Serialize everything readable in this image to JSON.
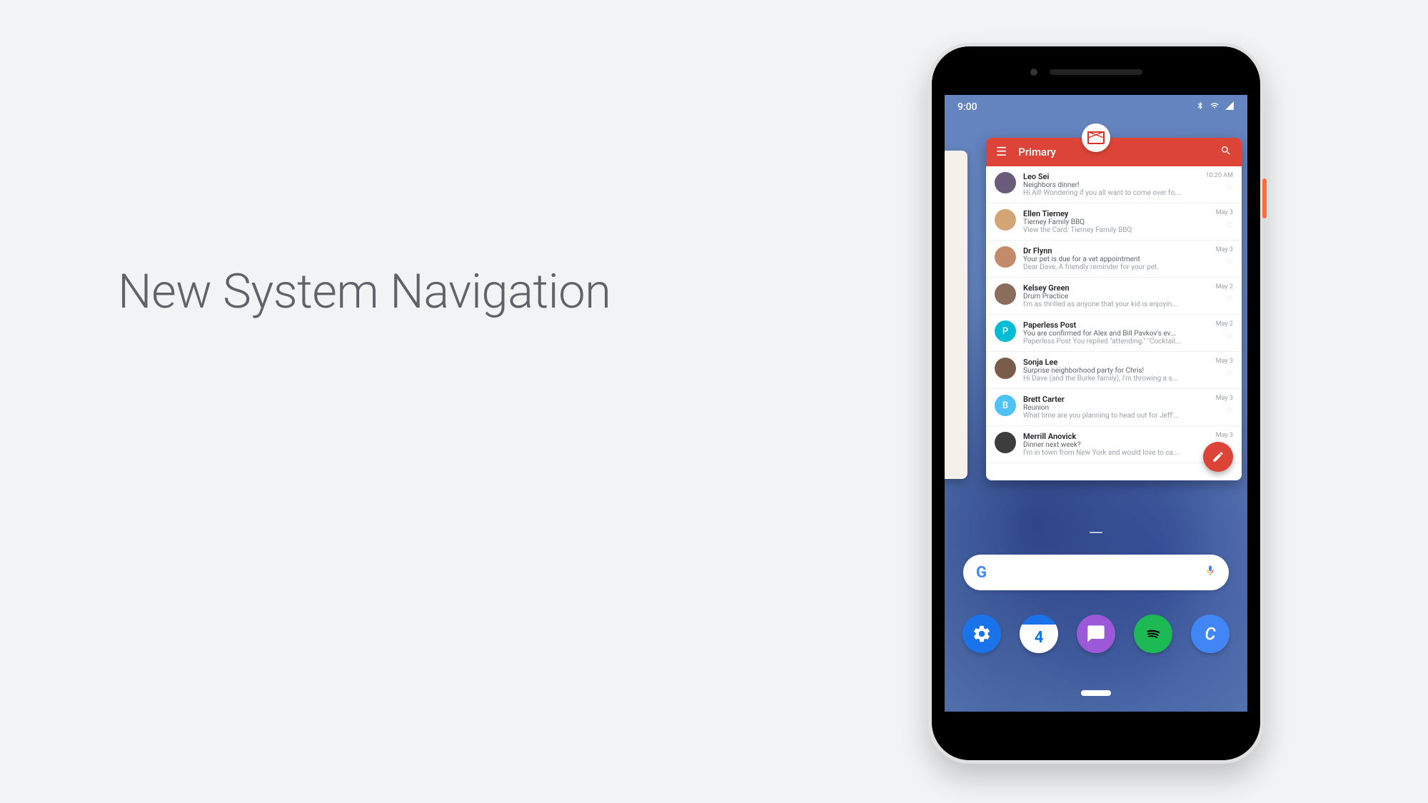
{
  "headline": "New System Navigation",
  "status": {
    "time": "9:00"
  },
  "gmail": {
    "tab_label": "Primary",
    "emails": [
      {
        "sender": "Leo Sei",
        "subject": "Neighbors dinner!",
        "preview": "Hi All! Wondering if you all want to come over fo...",
        "time": "10:20 AM",
        "avatar_bg": "#6b5b7b"
      },
      {
        "sender": "Ellen Tierney",
        "subject": "Tierney Family BBQ",
        "preview": "View the Card: Tierney Family BBQ",
        "time": "May 3",
        "avatar_bg": "#d4a574"
      },
      {
        "sender": "Dr Flynn",
        "subject": "Your pet is due for a vet appointment",
        "preview": "Dear Dave, A friendly reminder for your pet.",
        "time": "May 3",
        "avatar_bg": "#c48b6a"
      },
      {
        "sender": "Kelsey Green",
        "subject": "Drum Practice",
        "preview": "I'm as thrilled as anyone that your kid is enjoyin...",
        "time": "May 2",
        "avatar_bg": "#8a6d5a"
      },
      {
        "sender": "Paperless Post",
        "subject": "You are confirmed for Alex and Bill Pavkov's ev...",
        "preview": "Paperless Post You replied \"attending.\" \"Cocktail...",
        "time": "May 2",
        "avatar_bg": "#00bcd4",
        "letter": "P"
      },
      {
        "sender": "Sonja Lee",
        "subject": "Surprise neighborhood party for Chris!",
        "preview": "Hi Dave (and the Burke family), I'm throwing a s...",
        "time": "May 3",
        "avatar_bg": "#7a5c4a"
      },
      {
        "sender": "Brett Carter",
        "subject": "Reunion",
        "preview": "What time are you planning to head out for Jeff'...",
        "time": "May 3",
        "avatar_bg": "#4fc3f7",
        "letter": "B"
      },
      {
        "sender": "Merrill Anovick",
        "subject": "Dinner next week?",
        "preview": "I'm in town from New York and would love to ca...",
        "time": "May 3",
        "avatar_bg": "#3d3d3d"
      }
    ]
  },
  "dock": {
    "calendar_day": "4",
    "c_label": "C"
  }
}
